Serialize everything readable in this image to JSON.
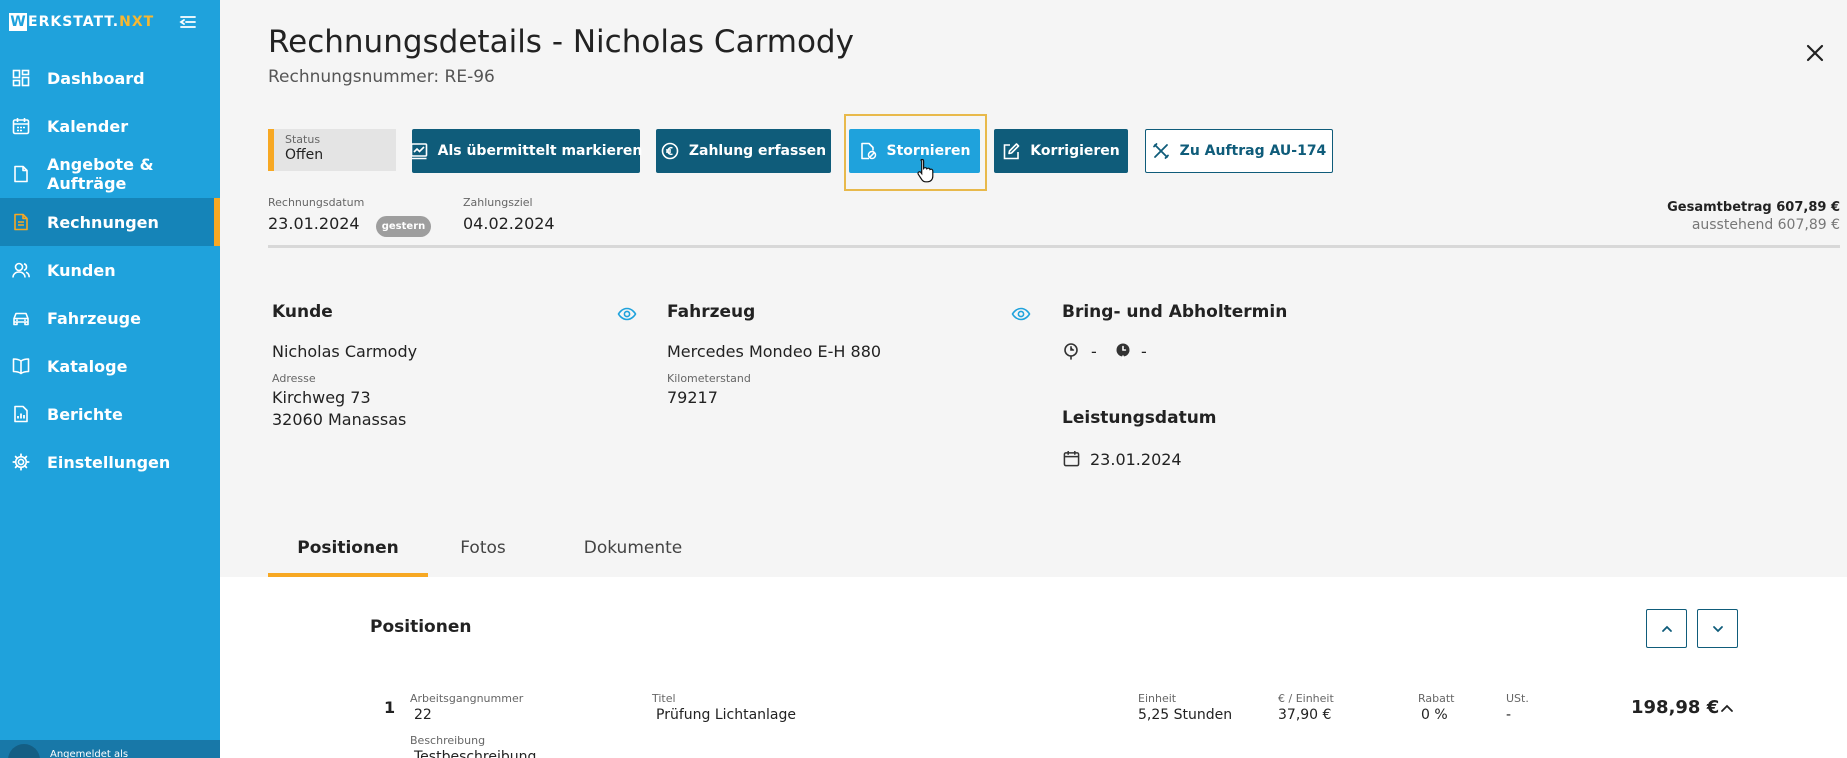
{
  "sidebar": {
    "logo_letter": "W",
    "logo_text": "ERKSTATT.",
    "logo_accent": "NXT",
    "items": [
      {
        "label": "Dashboard",
        "icon": "dashboard-icon"
      },
      {
        "label": "Kalender",
        "icon": "calendar-icon"
      },
      {
        "label": "Angebote & Aufträge",
        "icon": "document-icon"
      },
      {
        "label": "Rechnungen",
        "icon": "invoice-icon",
        "active": true
      },
      {
        "label": "Kunden",
        "icon": "users-icon"
      },
      {
        "label": "Fahrzeuge",
        "icon": "car-icon"
      },
      {
        "label": "Kataloge",
        "icon": "book-icon"
      },
      {
        "label": "Berichte",
        "icon": "report-icon"
      },
      {
        "label": "Einstellungen",
        "icon": "gear-icon"
      }
    ],
    "logged_in_as": "Angemeldet als"
  },
  "header": {
    "title": "Rechnungsdetails - Nicholas Carmody",
    "invoice_number": "Rechnungsnummer: RE-96"
  },
  "status": {
    "label": "Status",
    "value": "Offen"
  },
  "actions": {
    "mark_sent": "Als übermittelt markieren",
    "record_payment": "Zahlung erfassen",
    "cancel": "Stornieren",
    "correct": "Korrigieren",
    "to_order": "Zu Auftrag AU-174"
  },
  "dates": {
    "invoice_date_label": "Rechnungsdatum",
    "invoice_date": "23.01.2024",
    "badge": "gestern",
    "due_label": "Zahlungsziel",
    "due_date": "04.02.2024"
  },
  "totals": {
    "total": "Gesamtbetrag 607,89 €",
    "outstanding": "ausstehend 607,89 €"
  },
  "customer": {
    "heading": "Kunde",
    "name": "Nicholas Carmody",
    "address_label": "Adresse",
    "street": "Kirchweg 73",
    "city": "32060 Manassas"
  },
  "vehicle": {
    "heading": "Fahrzeug",
    "name": "Mercedes Mondeo E-H 880",
    "mileage_label": "Kilometerstand",
    "mileage": "79217"
  },
  "appointment": {
    "heading": "Bring- und Abholtermin",
    "bring": "-",
    "pickup": "-",
    "service_heading": "Leistungsdatum",
    "service_date": "23.01.2024"
  },
  "tabs": [
    {
      "label": "Positionen",
      "active": true
    },
    {
      "label": "Fotos"
    },
    {
      "label": "Dokumente"
    }
  ],
  "positions": {
    "title": "Positionen",
    "row": {
      "index": "1",
      "op_label": "Arbeitsgangnummer",
      "op_value": "22",
      "title_label": "Titel",
      "title_value": "Prüfung Lichtanlage",
      "unit_label": "Einheit",
      "unit_value": "5,25 Stunden",
      "price_label": "€ / Einheit",
      "price_value": "37,90 €",
      "discount_label": "Rabatt",
      "discount_value": "0 %",
      "vat_label": "USt.",
      "vat_value": "-",
      "total": "198,98 €",
      "desc_label": "Beschreibung",
      "desc_value": "Testbeschreibung"
    }
  },
  "colors": {
    "sidebar": "#1fa2dc",
    "sidebar_active": "#1584b8",
    "accent": "#f7a823",
    "primary_dark": "#0f5c7a"
  }
}
